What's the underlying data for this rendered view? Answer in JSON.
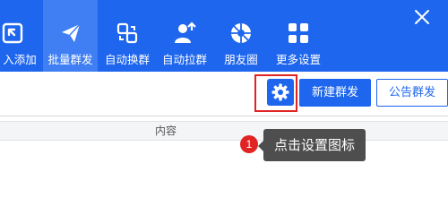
{
  "colors": {
    "brand": "#1e66ee",
    "active_tab": "#3f7ff3",
    "highlight": "#e02424",
    "tooltip_bg": "#4e4e4e"
  },
  "toolbar": {
    "items": [
      {
        "label": "入添加",
        "icon": "import-icon",
        "active": false
      },
      {
        "label": "批量群发",
        "icon": "send-icon",
        "active": true
      },
      {
        "label": "自动换群",
        "icon": "switch-group-icon",
        "active": false
      },
      {
        "label": "自动拉群",
        "icon": "add-user-icon",
        "active": false
      },
      {
        "label": "朋友圈",
        "icon": "moments-icon",
        "active": false
      },
      {
        "label": "更多设置",
        "icon": "more-grid-icon",
        "active": false
      }
    ],
    "close_icon": "close-icon"
  },
  "actions": {
    "settings_icon": "gear-icon",
    "new_group_label": "新建群发",
    "announcement_label": "公告群发"
  },
  "table": {
    "columns": [
      "内容"
    ]
  },
  "guide": {
    "step": "1",
    "tooltip": "点击设置图标"
  }
}
